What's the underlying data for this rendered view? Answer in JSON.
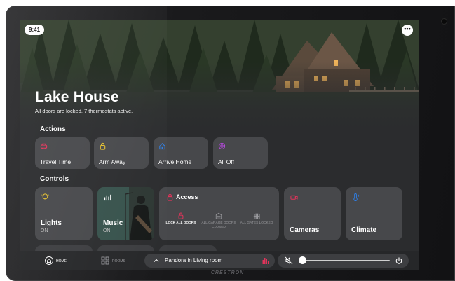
{
  "status": {
    "time": "9:41",
    "more_glyph": "•••"
  },
  "header": {
    "title": "Lake House",
    "subtitle": "All doors are locked. 7 thermostats active."
  },
  "actions": {
    "label": "Actions",
    "items": [
      {
        "label": "Travel Time",
        "icon": "car-icon",
        "color": "#e0345a"
      },
      {
        "label": "Arm Away",
        "icon": "padlock-icon",
        "color": "#e6c12e"
      },
      {
        "label": "Arrive Home",
        "icon": "home-icon",
        "color": "#2f7de1"
      },
      {
        "label": "All Off",
        "icon": "power-ring-icon",
        "color": "#b04ad6"
      }
    ]
  },
  "controls": {
    "label": "Controls",
    "lights": {
      "label": "Lights",
      "state": "ON",
      "icon": "lightbulb-icon",
      "color": "#e6c12e"
    },
    "music": {
      "label": "Music",
      "state": "ON",
      "icon": "equalizer-icon"
    },
    "access": {
      "title": "Access",
      "icon": "lock-icon",
      "color": "#e0345a",
      "items": [
        {
          "text": "LOCK ALL DOORS",
          "icon": "unlock-icon"
        },
        {
          "text": "ALL GARAGE DOORS CLOSED",
          "icon": "garage-icon"
        },
        {
          "text": "ALL GATES LOCKED",
          "icon": "gate-icon"
        }
      ]
    },
    "cameras": {
      "label": "Cameras",
      "icon": "camera-icon",
      "color": "#e0345a"
    },
    "climate": {
      "label": "Climate",
      "icon": "thermometer-icon",
      "color": "#2f7de1"
    }
  },
  "bottom_nav": {
    "home_label": "HOME",
    "rooms_label": "ROOMS",
    "now_playing": "Pandora in Living room",
    "volume_level": 0.06
  },
  "brand": "CRESTRON"
}
